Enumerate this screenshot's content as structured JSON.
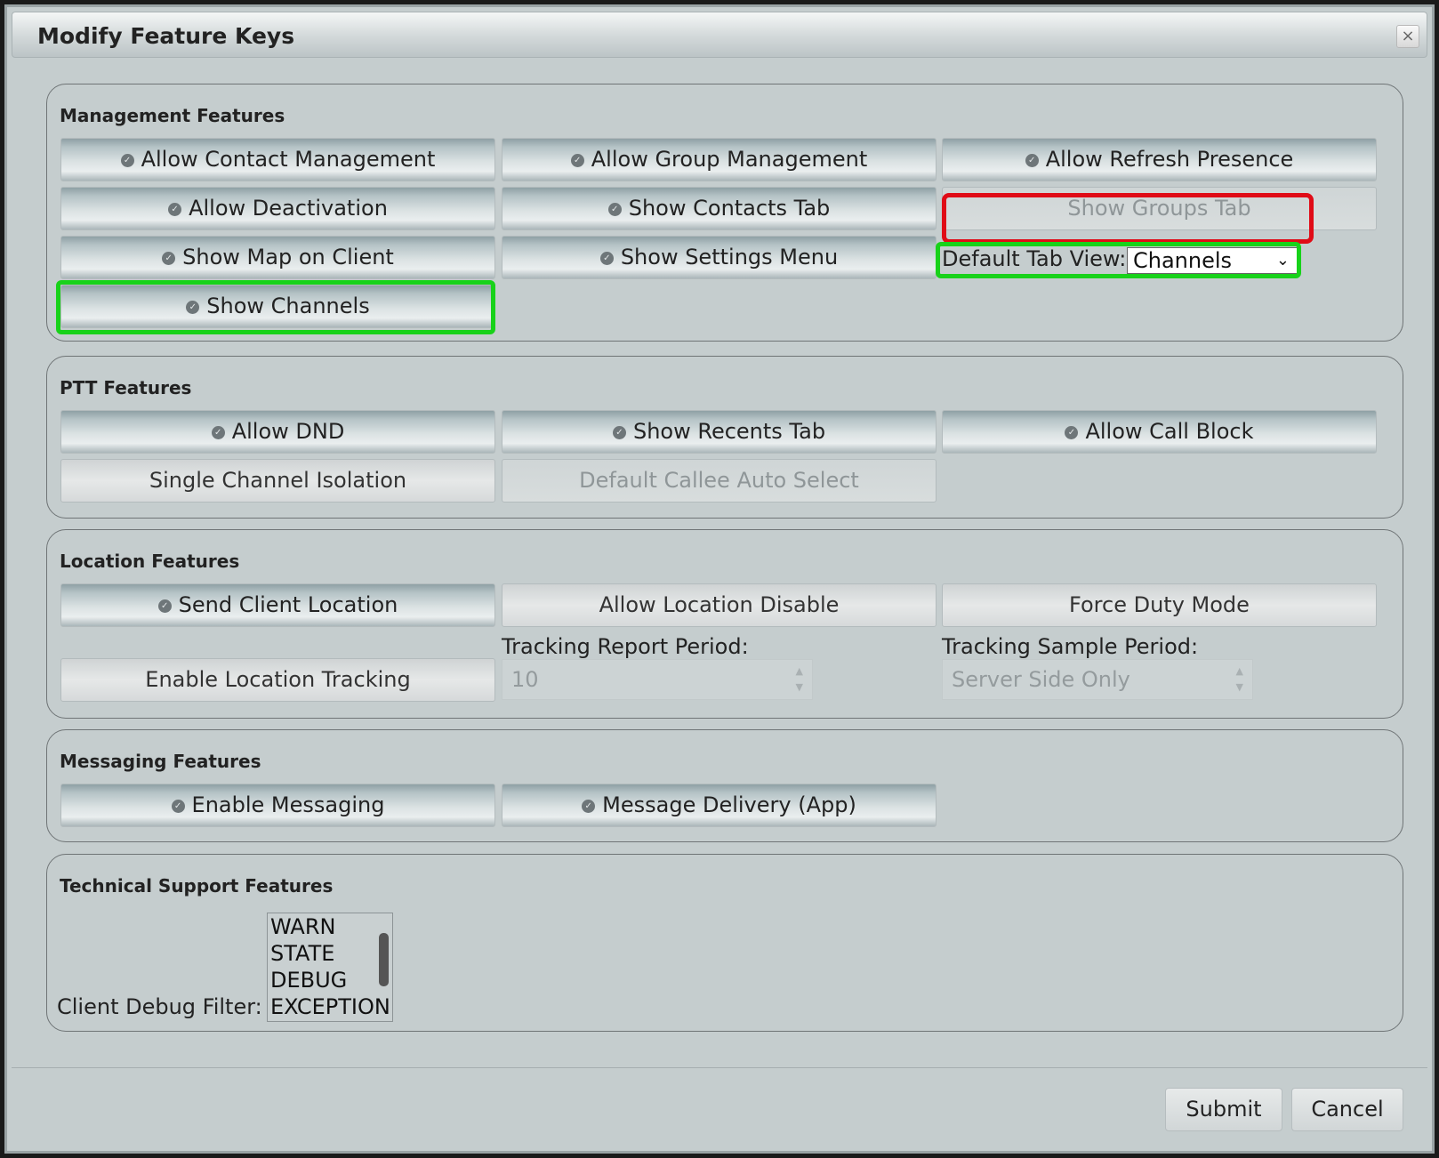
{
  "dialog": {
    "title": "Modify Feature Keys",
    "close_label": "×"
  },
  "management": {
    "legend": "Management Features",
    "buttons": {
      "allow_contact_mgmt": "Allow Contact Management",
      "allow_group_mgmt": "Allow Group Management",
      "allow_refresh_presence": "Allow Refresh Presence",
      "allow_deactivation": "Allow Deactivation",
      "show_contacts_tab": "Show Contacts Tab",
      "show_groups_tab": "Show Groups Tab",
      "show_map": "Show Map on Client",
      "show_settings_menu": "Show Settings Menu",
      "show_channels": "Show Channels"
    },
    "default_tab_label": "Default Tab View:",
    "default_tab_value": "Channels"
  },
  "ptt": {
    "legend": "PTT Features",
    "buttons": {
      "allow_dnd": "Allow DND",
      "show_recents_tab": "Show Recents Tab",
      "allow_call_block": "Allow Call Block",
      "single_channel_isolation": "Single Channel Isolation",
      "default_callee_auto_select": "Default Callee Auto Select"
    }
  },
  "location": {
    "legend": "Location Features",
    "buttons": {
      "send_client_location": "Send Client Location",
      "allow_location_disable": "Allow Location Disable",
      "force_duty_mode": "Force Duty Mode",
      "enable_location_tracking": "Enable Location Tracking"
    },
    "tracking_report_label": "Tracking Report Period:",
    "tracking_report_value": "10",
    "tracking_sample_label": "Tracking Sample Period:",
    "tracking_sample_value": "Server Side Only"
  },
  "messaging": {
    "legend": "Messaging Features",
    "buttons": {
      "enable_messaging": "Enable Messaging",
      "message_delivery": "Message Delivery (App)"
    }
  },
  "tech_support": {
    "legend": "Technical Support Features",
    "debug_filter_label": "Client Debug Filter:",
    "debug_options": [
      "WARN",
      "STATE",
      "DEBUG",
      "EXCEPTION"
    ]
  },
  "footer": {
    "submit_label": "Submit",
    "cancel_label": "Cancel"
  },
  "colors": {
    "highlight_red": "#e00b16",
    "highlight_green": "#18d21a"
  }
}
